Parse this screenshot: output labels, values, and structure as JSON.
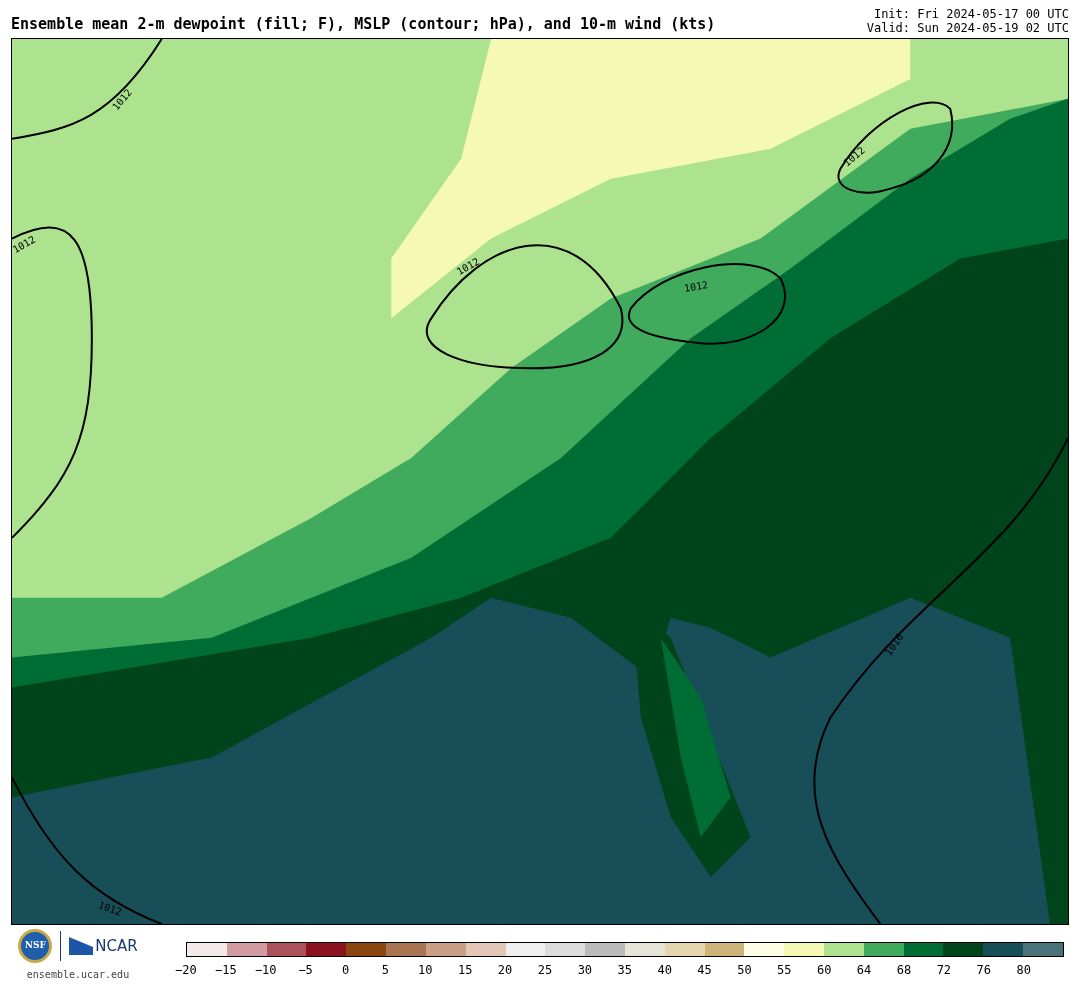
{
  "header": {
    "title": "Ensemble mean 2-m dewpoint (fill; F), MSLP (contour; hPa), and 10-m wind (kts)",
    "init": "Init: Fri 2024-05-17 00 UTC",
    "valid": "Valid: Sun 2024-05-19 02 UTC"
  },
  "map": {
    "contour_labels": [
      "1012",
      "1012",
      "1012",
      "1012",
      "1012",
      "1012",
      "1016"
    ]
  },
  "footer": {
    "logo_left": "NSF",
    "logo_right": "NCAR",
    "site": "ensemble.ucar.edu"
  },
  "colorbar": {
    "bins": [
      {
        "color": "#f3e9ea"
      },
      {
        "color": "#d09ca2"
      },
      {
        "color": "#ab525a"
      },
      {
        "color": "#8b1320"
      },
      {
        "color": "#8a4510"
      },
      {
        "color": "#a97452"
      },
      {
        "color": "#c9a086"
      },
      {
        "color": "#e3c7b6"
      },
      {
        "color": "#f0f0f0"
      },
      {
        "color": "#dcdcdc"
      },
      {
        "color": "#bababa"
      },
      {
        "color": "#e5e4d6"
      },
      {
        "color": "#e6d6ad"
      },
      {
        "color": "#cdb478"
      },
      {
        "color": "#fefee4"
      },
      {
        "color": "#f6f9b4"
      },
      {
        "color": "#ade28f"
      },
      {
        "color": "#41ab5d"
      },
      {
        "color": "#006d35"
      },
      {
        "color": "#00441b"
      },
      {
        "color": "#174e58"
      },
      {
        "color": "#497379"
      }
    ],
    "ticks": [
      "−20",
      "−15",
      "−10",
      "−5",
      "0",
      "5",
      "10",
      "15",
      "20",
      "25",
      "30",
      "35",
      "40",
      "45",
      "50",
      "55",
      "60",
      "64",
      "68",
      "72",
      "76",
      "80"
    ]
  }
}
